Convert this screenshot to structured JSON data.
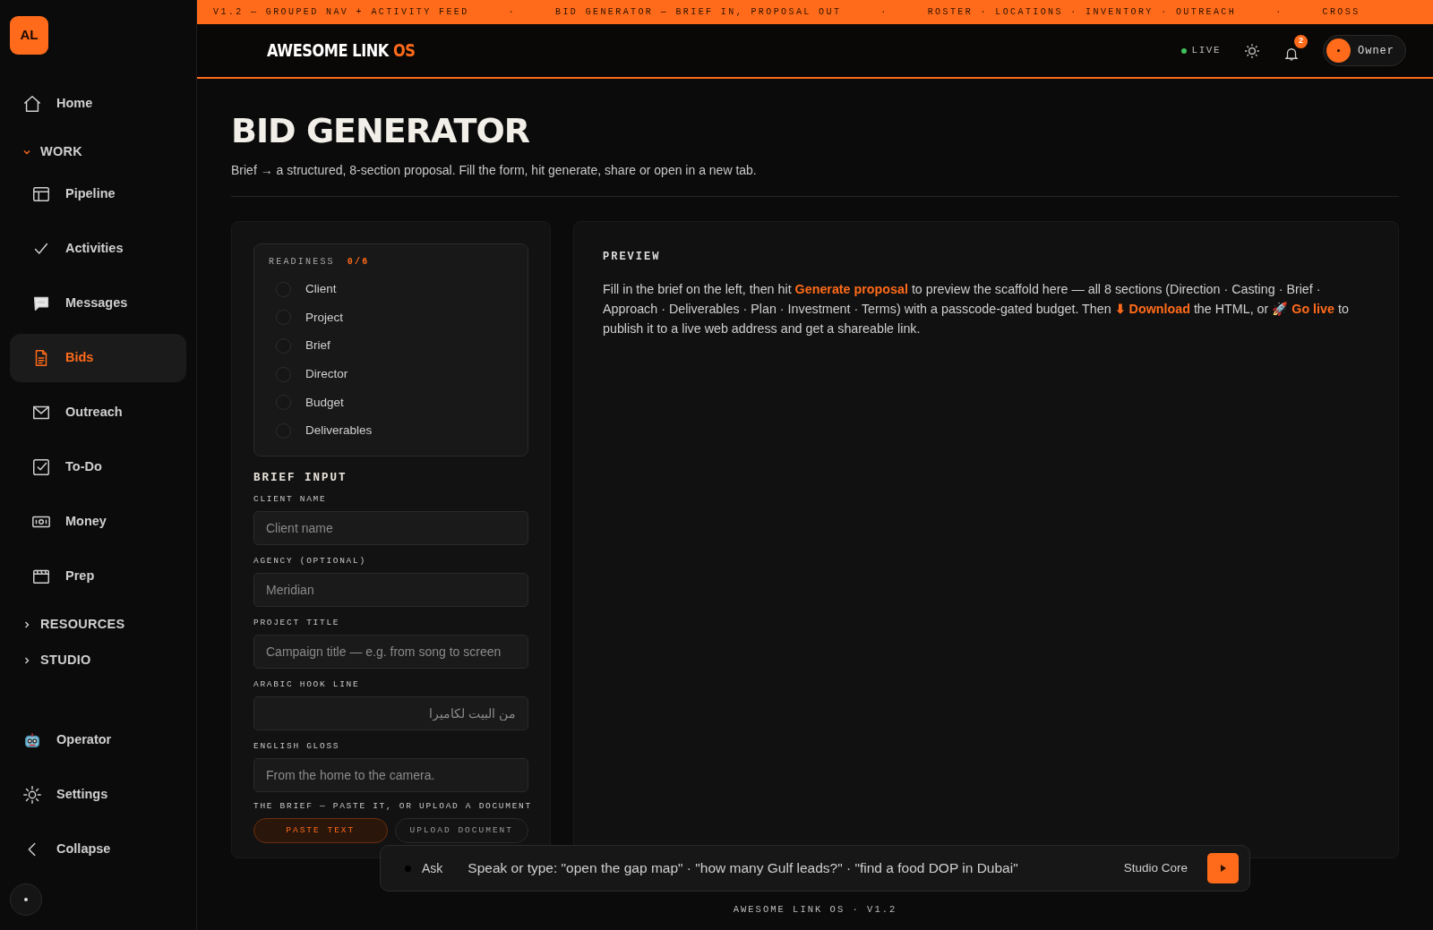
{
  "sidebar": {
    "logo": "AL",
    "items": [
      {
        "kind": "link",
        "label": "Home",
        "selected": false
      },
      {
        "kind": "group",
        "label": "WORK",
        "expanded": true,
        "children": [
          {
            "label": "Pipeline",
            "selected": false
          },
          {
            "label": "Activities",
            "selected": false
          },
          {
            "label": "Messages",
            "selected": false
          },
          {
            "label": "Bids",
            "selected": true
          },
          {
            "label": "Outreach",
            "selected": false
          },
          {
            "label": "To-Do",
            "selected": false
          },
          {
            "label": "Money",
            "selected": false
          },
          {
            "label": "Prep",
            "selected": false
          }
        ]
      },
      {
        "kind": "group",
        "label": "RESOURCES",
        "expanded": false
      },
      {
        "kind": "group",
        "label": "STUDIO",
        "expanded": false
      }
    ],
    "footer_items": [
      {
        "label": "Operator"
      },
      {
        "label": "Settings"
      },
      {
        "label": "Collapse"
      }
    ]
  },
  "ticker": [
    "V1.2 — GROUPED NAV + ACTIVITY FEED",
    "·",
    "BID GENERATOR — BRIEF IN, PROPOSAL OUT",
    "·",
    "ROSTER · LOCATIONS · INVENTORY · OUTREACH",
    "·",
    "CROSS"
  ],
  "header": {
    "brand": "AWESOME LINK",
    "brand_suffix": "OS",
    "live": "LIVE",
    "notifications": "2",
    "user": "Owner"
  },
  "page": {
    "title": "BID GENERATOR",
    "subtitle": "Brief → a structured, 8-section proposal. Fill the form, hit generate, share or open in a new tab."
  },
  "readiness": {
    "label": "READINESS",
    "count": "0/6",
    "items": [
      {
        "label": "Client",
        "checked": false
      },
      {
        "label": "Project",
        "checked": false
      },
      {
        "label": "Brief",
        "checked": false
      },
      {
        "label": "Director",
        "checked": false
      },
      {
        "label": "Budget",
        "checked": false
      },
      {
        "label": "Deliverables",
        "checked": false
      }
    ]
  },
  "brief_input": {
    "title": "BRIEF INPUT",
    "fields": [
      {
        "label": "CLIENT NAME",
        "placeholder": "Client name",
        "rtl": false
      },
      {
        "label": "AGENCY (OPTIONAL)",
        "placeholder": "Meridian",
        "rtl": false
      },
      {
        "label": "PROJECT TITLE",
        "placeholder": "Campaign title — e.g. from song to screen",
        "rtl": false
      },
      {
        "label": "ARABIC HOOK LINE",
        "placeholder": "من البيت لكاميرا",
        "rtl": true
      },
      {
        "label": "ENGLISH GLOSS",
        "placeholder": "From the home to the camera.",
        "rtl": false
      }
    ],
    "source_label": "THE BRIEF — PASTE IT, OR UPLOAD A DOCUMENT",
    "source_tabs": [
      {
        "label": "PASTE TEXT",
        "selected": true
      },
      {
        "label": "UPLOAD DOCUMENT",
        "selected": false
      }
    ]
  },
  "preview": {
    "title": "PREVIEW",
    "parts": [
      {
        "kind": "text",
        "text": "Fill in the brief on the left, then hit "
      },
      {
        "kind": "link",
        "text": "Generate proposal"
      },
      {
        "kind": "text",
        "text": " to preview the scaffold here — all 8 sections (Direction · Casting · Brief · Approach · Deliverables · Plan · Investment · Terms) with a passcode-gated budget. Then "
      },
      {
        "kind": "link",
        "text": "⬇ Download"
      },
      {
        "kind": "text",
        "text": " the HTML, or 🚀 "
      },
      {
        "kind": "link",
        "text": "Go live"
      },
      {
        "kind": "text",
        "text": " to publish it to a live web address and get a shareable link."
      }
    ]
  },
  "ask_bar": {
    "label": "Ask",
    "placeholder": "Speak or type: \"open the gap map\" · \"how many Gulf leads?\" · \"find a food DOP in Dubai\"",
    "model": "Studio Core"
  },
  "footer": "AWESOME LINK OS · V1.2"
}
